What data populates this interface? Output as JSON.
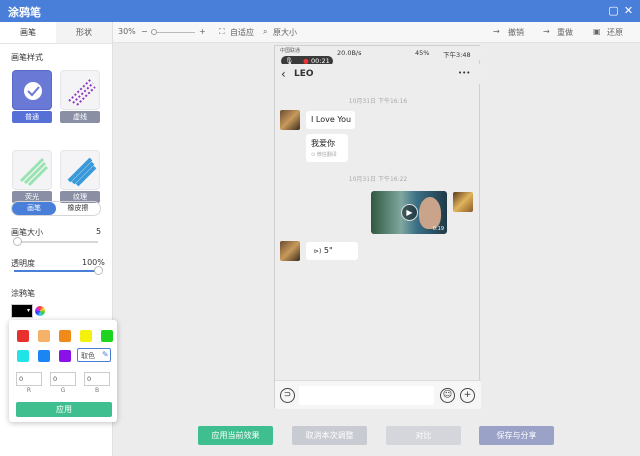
{
  "app": {
    "title": "涂鸦笔"
  },
  "left": {
    "tabs": [
      {
        "label": "画笔"
      },
      {
        "label": "形状"
      }
    ],
    "brush_style_label": "画笔样式",
    "brushes": [
      {
        "label": "普通"
      },
      {
        "label": "虚线"
      },
      {
        "label": "荧光"
      },
      {
        "label": "纹理"
      }
    ],
    "mode": [
      {
        "label": "画笔"
      },
      {
        "label": "橡皮擦"
      }
    ],
    "size_label": "画笔大小",
    "size_value": "5",
    "opacity_label": "透明度",
    "opacity_value": "100%",
    "pen_label": "涂鸦笔",
    "size_fraction": 0.04,
    "opacity_fraction": 1.0
  },
  "topbar": {
    "zoom": "30%",
    "zoom_minus": "−",
    "zoom_plus": "+",
    "fit": "自适应",
    "original": "原大小",
    "undo": "撤销",
    "redo": "重做",
    "restore": "还原"
  },
  "phone": {
    "status_carrier": "中国联通",
    "status_right": "20.0B/s",
    "status_battery": "45%",
    "status_time": "下午3:48",
    "rec_time": "00:21",
    "contact": "LEO",
    "more": "•••",
    "back": "‹",
    "ts1": "10月31日 下午16:16",
    "msg1": "I Love You",
    "msg2": "我爱你",
    "msg2_sub": "⊙ 微信翻译",
    "ts2": "10月31日 下午16:22",
    "video_duration": "0:19",
    "voice": "5\"",
    "voice_icon": "⊳)"
  },
  "color_popup": {
    "colors": [
      "#e8302c",
      "#f5b06a",
      "#f08a1a",
      "#f4f10c",
      "#1fd41f",
      "#1fe5e8",
      "#1a86f2",
      "#8a12e8"
    ],
    "picker_label": "取色",
    "r": "0",
    "g": "0",
    "b": "0",
    "r_label": "R",
    "g_label": "G",
    "b_label": "B",
    "apply": "应用",
    "selected_color": "#000000"
  },
  "bottom": {
    "apply_current": "应用当前效果",
    "cancel": "取消本次调整",
    "compare": "对比",
    "save_share": "保存与分享"
  }
}
